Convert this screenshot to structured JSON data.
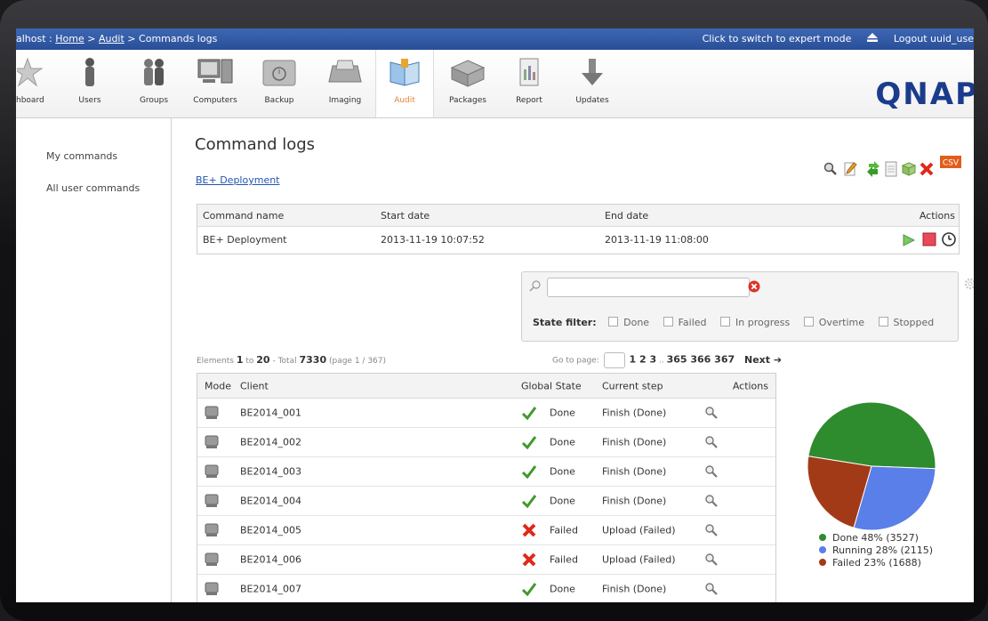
{
  "topbar": {
    "crumb_prefix": "alhost : ",
    "crumb_home": "Home",
    "crumb_sep1": " > ",
    "crumb_audit": "Audit",
    "crumb_sep2": " > ",
    "crumb_current": "Commands logs",
    "expert_mode": "Click to switch to expert mode",
    "logout": "Logout uuid_use"
  },
  "toolbar": {
    "items": [
      {
        "label": "hboard",
        "icon": "star-icon"
      },
      {
        "label": "Users",
        "icon": "user-icon"
      },
      {
        "label": "Groups",
        "icon": "group-icon"
      },
      {
        "label": "Computers",
        "icon": "computer-icon"
      },
      {
        "label": "Backup",
        "icon": "backup-icon"
      },
      {
        "label": "Imaging",
        "icon": "imaging-icon"
      },
      {
        "label": "Audit",
        "icon": "audit-book-icon"
      },
      {
        "label": "Packages",
        "icon": "package-box-icon"
      },
      {
        "label": "Report",
        "icon": "report-icon"
      },
      {
        "label": "Updates",
        "icon": "download-arrow-icon"
      }
    ],
    "brand": "QNAP"
  },
  "sidebar": {
    "items": [
      {
        "label": "My commands"
      },
      {
        "label": "All user commands"
      }
    ]
  },
  "main": {
    "title": "Command logs",
    "sublink": "BE+ Deployment",
    "action_icons": [
      "search-icon",
      "edit-icon",
      "transfer-icon",
      "document-icon",
      "package-icon",
      "delete-icon",
      "csv-export-icon"
    ],
    "csv_label": "CSV",
    "command_table": {
      "headers": [
        "Command name",
        "Start date",
        "End date",
        "Actions"
      ],
      "row": {
        "name": "BE+ Deployment",
        "start": "2013-11-19 10:07:52",
        "end": "2013-11-19 11:08:00"
      }
    },
    "filter": {
      "search_value": "",
      "state_label": "State filter:",
      "options": [
        "Done",
        "Failed",
        "In progress",
        "Overtime",
        "Stopped"
      ]
    },
    "pagination": {
      "elements_label": "Elements",
      "from": "1",
      "to_label": "to",
      "to": "20",
      "total_label": "- Total",
      "total": "7330",
      "page_info": "(page 1 / 367)",
      "goto_label": "Go to page:",
      "pages_a": "1 2 3",
      "ellipsis": " .. ",
      "pages_b": "365 366 367",
      "next": "Next"
    },
    "client_table": {
      "headers": [
        "Mode",
        "Client",
        "Global State",
        "Current step",
        "Actions"
      ],
      "rows": [
        {
          "client": "BE2014_001",
          "state": "Done",
          "step": "Finish (Done)",
          "ok": true
        },
        {
          "client": "BE2014_002",
          "state": "Done",
          "step": "Finish (Done)",
          "ok": true
        },
        {
          "client": "BE2014_003",
          "state": "Done",
          "step": "Finish (Done)",
          "ok": true
        },
        {
          "client": "BE2014_004",
          "state": "Done",
          "step": "Finish (Done)",
          "ok": true
        },
        {
          "client": "BE2014_005",
          "state": "Failed",
          "step": "Upload (Failed)",
          "ok": false
        },
        {
          "client": "BE2014_006",
          "state": "Failed",
          "step": "Upload (Failed)",
          "ok": false
        },
        {
          "client": "BE2014_007",
          "state": "Done",
          "step": "Finish (Done)",
          "ok": true
        }
      ]
    }
  },
  "chart_data": {
    "type": "pie",
    "slices": [
      {
        "name": "Done",
        "percent": 48,
        "count": 3527,
        "label": "Done 48% (3527)",
        "color": "#2e8b2e"
      },
      {
        "name": "Running",
        "percent": 28,
        "count": 2115,
        "label": "Running 28% (2115)",
        "color": "#5b7fe8"
      },
      {
        "name": "Failed",
        "percent": 23,
        "count": 1688,
        "label": "Failed 23% (1688)",
        "color": "#a33a17"
      }
    ]
  },
  "colors": {
    "topbar": "#2f57a3",
    "link": "#2555b0",
    "done_check": "#3f9a2a",
    "failed_x": "#e0281b"
  }
}
